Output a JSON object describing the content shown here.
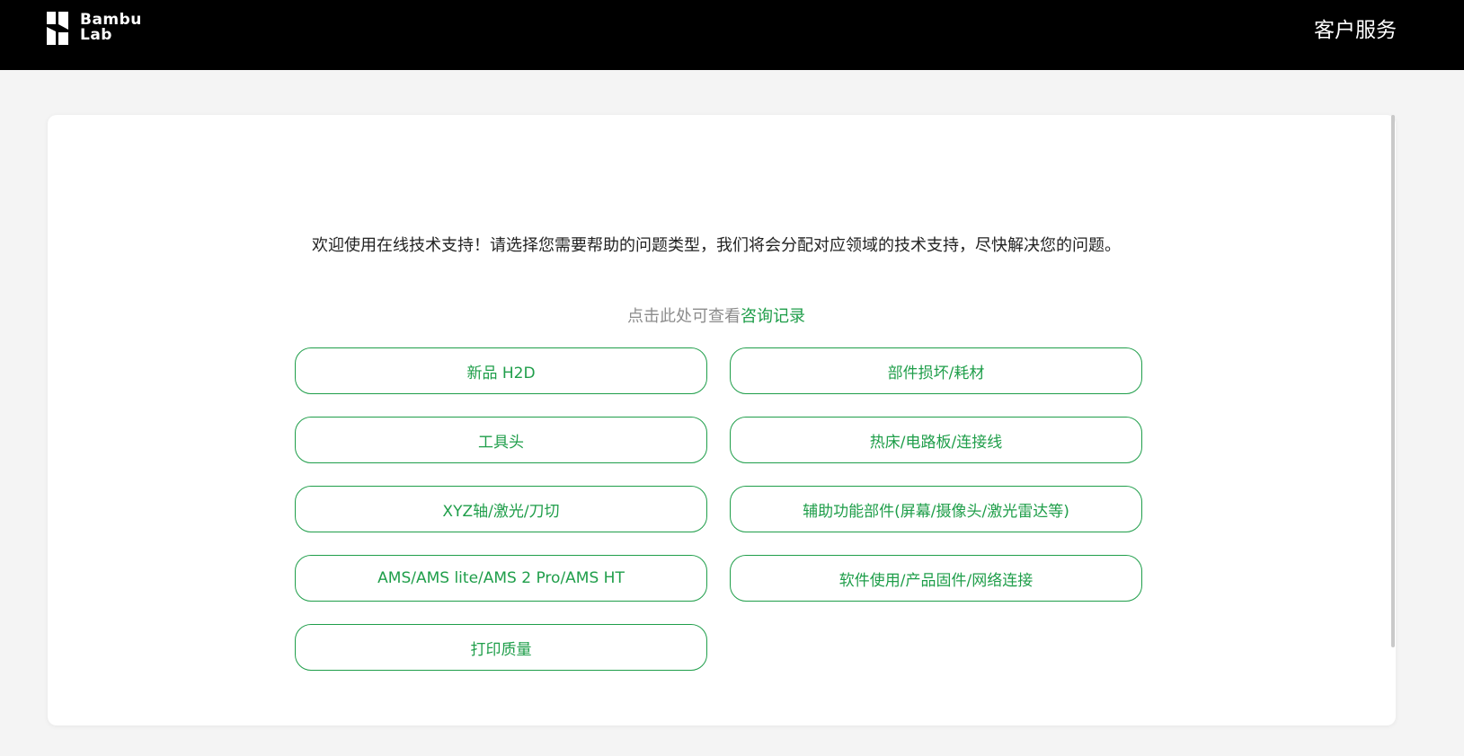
{
  "header": {
    "logo": {
      "line1": "Bambu",
      "line2": "Lab"
    },
    "title": "客户服务"
  },
  "main": {
    "welcome_text": "欢迎使用在线技术支持！请选择您需要帮助的问题类型，我们将会分配对应领域的技术支持，尽快解决您的问题。",
    "history_prefix": "点击此处可查看",
    "history_link": "咨询记录",
    "options": [
      {
        "label": "新品 H2D"
      },
      {
        "label": "部件损坏/耗材"
      },
      {
        "label": "工具头"
      },
      {
        "label": "热床/电路板/连接线"
      },
      {
        "label": "XYZ轴/激光/刀切"
      },
      {
        "label": "辅助功能部件(屏幕/摄像头/激光雷达等)"
      },
      {
        "label": "AMS/AMS lite/AMS 2 Pro/AMS HT"
      },
      {
        "label": "软件使用/产品固件/网络连接"
      },
      {
        "label": "打印质量"
      }
    ]
  },
  "colors": {
    "accent": "#1f9e4a",
    "header_bg": "#000000",
    "page_bg": "#f4f4f4"
  }
}
